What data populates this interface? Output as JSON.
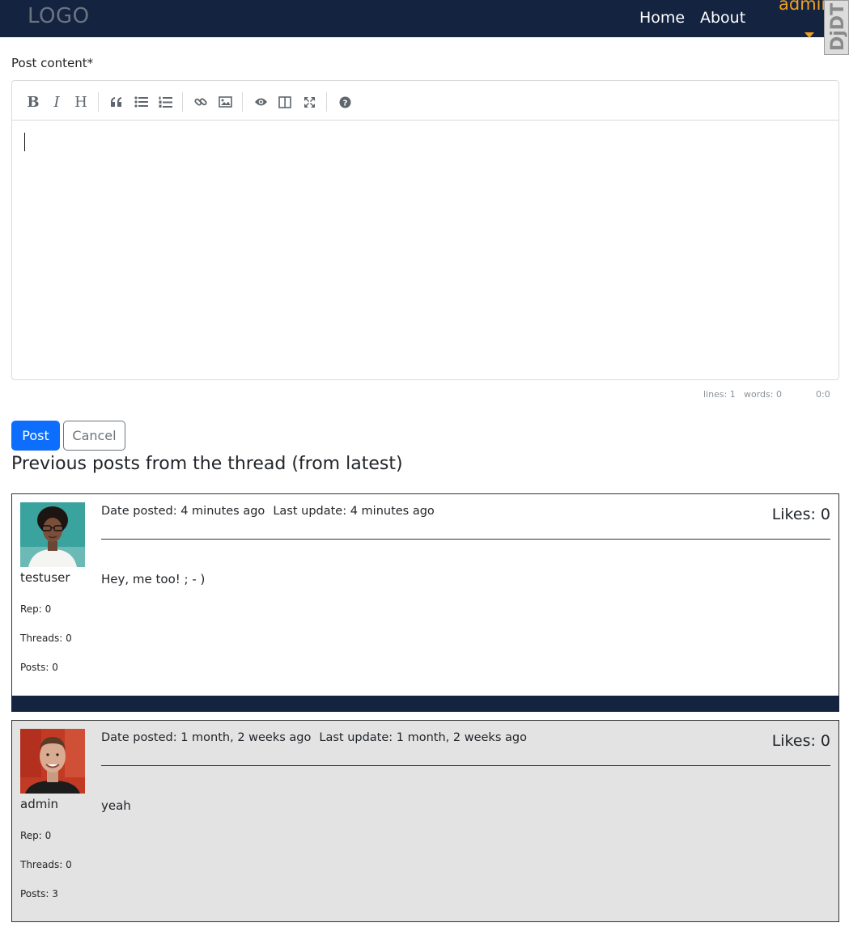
{
  "navbar": {
    "logo": "LOGO",
    "links": {
      "home": "Home",
      "about": "About"
    },
    "user": "admin",
    "extension_badge": "DjDT"
  },
  "form": {
    "label": "Post content*",
    "editor_value": "",
    "toolbar": [
      "bold-icon",
      "italic-icon",
      "heading-icon",
      "quote-icon",
      "unordered-list-icon",
      "ordered-list-icon",
      "link-icon",
      "image-icon",
      "preview-icon",
      "side-by-side-icon",
      "fullscreen-icon",
      "help-icon"
    ],
    "statusbar": {
      "lines": "lines: 1",
      "words": "words: 0",
      "cursor": "0:0"
    },
    "post_button": "Post",
    "cancel_button": "Cancel"
  },
  "thread": {
    "title": "Previous posts from the thread (from latest)",
    "posts": [
      {
        "username": "testuser",
        "rep": "Rep: 0",
        "threads": "Threads: 0",
        "posts": "Posts: 0",
        "date_posted": "Date posted: 4 minutes ago",
        "last_update": "Last update: 4 minutes ago",
        "likes": "Likes: 0",
        "content": "Hey, me too! ; - )",
        "background": "#ffffff"
      },
      {
        "username": "admin",
        "rep": "Rep: 0",
        "threads": "Threads: 0",
        "posts": "Posts: 3",
        "date_posted": "Date posted: 1 month, 2 weeks ago",
        "last_update": "Last update: 1 month, 2 weeks ago",
        "likes": "Likes: 0",
        "content": "yeah",
        "background": "#e3e3e3"
      }
    ]
  },
  "colors": {
    "navbar": "#142340",
    "accent_user": "#f0a020",
    "primary_button": "#0d6efd"
  }
}
